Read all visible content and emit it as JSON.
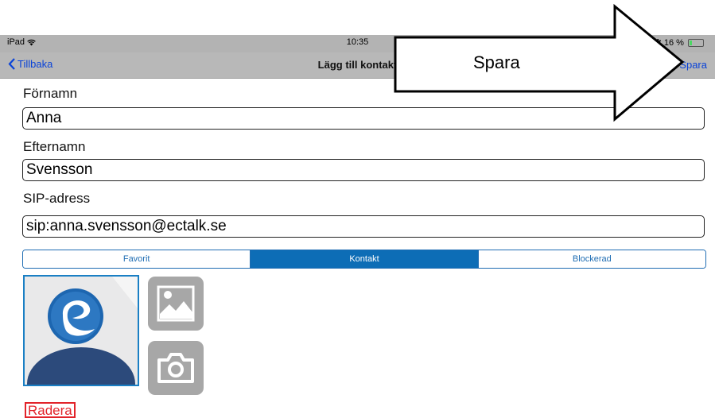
{
  "status_bar": {
    "device": "iPad",
    "time": "10:35",
    "battery": "16 %",
    "battery_level": 0.16
  },
  "nav": {
    "back_label": "Tillbaka",
    "title": "Lägg till kontakt",
    "save_label": "Spara"
  },
  "form": {
    "first_name": {
      "label": "Förnamn",
      "value": "Anna"
    },
    "last_name": {
      "label": "Efternamn",
      "value": "Svensson"
    },
    "sip": {
      "label": "SIP-adress",
      "value": "sip:anna.svensson@ectalk.se"
    }
  },
  "segments": {
    "items": [
      "Favorit",
      "Kontakt",
      "Blockerad"
    ],
    "selected": "Kontakt"
  },
  "photo": {
    "avatar_icon": "person-avatar-icon",
    "gallery_icon": "image-gallery-icon",
    "camera_icon": "camera-icon"
  },
  "delete_label": "Radera",
  "annotation": {
    "text": "Spara"
  },
  "colors": {
    "accent": "#0a43d8",
    "segment_active": "#0d6db6",
    "delete": "#e2232a",
    "bar_gray": "#b8b8b8"
  }
}
